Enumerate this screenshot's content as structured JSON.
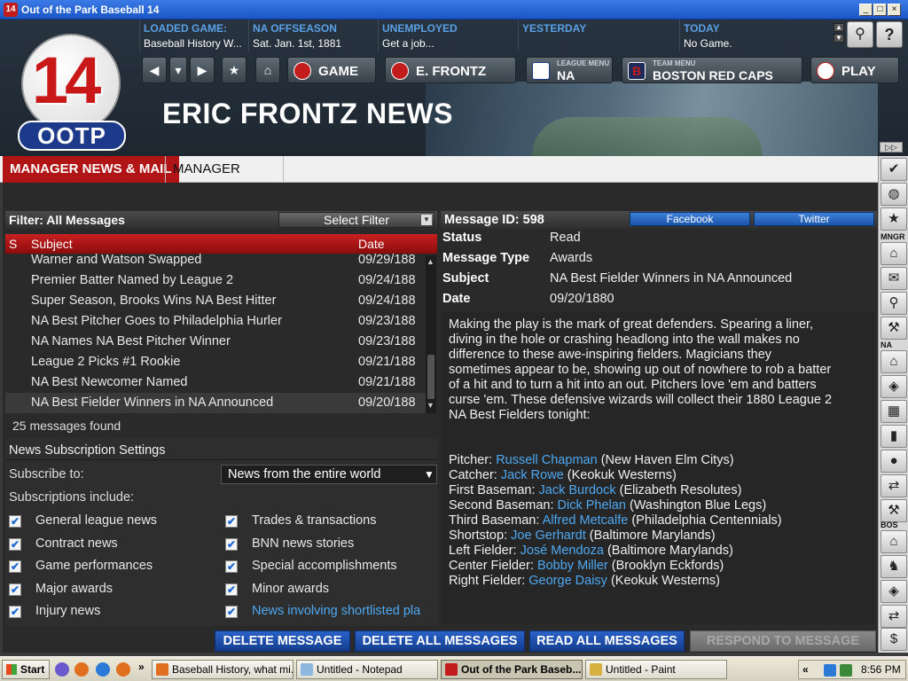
{
  "window": {
    "title": "Out of the Park Baseball 14",
    "app_icon": "14"
  },
  "logo": {
    "number": "14",
    "text": "OOTP"
  },
  "info": [
    {
      "label": "LOADED GAME:",
      "value": "Baseball History W..."
    },
    {
      "label": "NA OFFSEASON",
      "value": "Sat. Jan. 1st, 1881"
    },
    {
      "label": "UNEMPLOYED",
      "value": "Get a job..."
    },
    {
      "label": "YESTERDAY",
      "value": ""
    },
    {
      "label": "TODAY",
      "value": "No Game."
    }
  ],
  "nav": {
    "game": "GAME",
    "manager": "E. FRONTZ",
    "league_sub": "LEAGUE MENU",
    "league": "NA",
    "team_sub": "TEAM MENU",
    "team": "BOSTON RED CAPS",
    "play": "PLAY"
  },
  "page_title": "ERIC FRONTZ NEWS",
  "tabs": [
    "MANAGER NEWS & MAIL",
    "MANAGER NOTES"
  ],
  "filter": {
    "label": "Filter: All Messages",
    "select": "Select Filter"
  },
  "columns": {
    "s": "S",
    "subject": "Subject",
    "date": "Date"
  },
  "messages": [
    {
      "subject": "Warner and Watson Swapped",
      "date": "09/29/188"
    },
    {
      "subject": "Premier Batter Named by League 2",
      "date": "09/24/188"
    },
    {
      "subject": "Super Season, Brooks Wins NA Best Hitter",
      "date": "09/24/188"
    },
    {
      "subject": "NA Best Pitcher Goes to Philadelphia Hurler",
      "date": "09/23/188"
    },
    {
      "subject": "NA Names NA Best Pitcher Winner",
      "date": "09/23/188"
    },
    {
      "subject": "League 2 Picks #1 Rookie",
      "date": "09/21/188"
    },
    {
      "subject": "NA Best Newcomer Named",
      "date": "09/21/188"
    },
    {
      "subject": "NA Best Fielder Winners in NA Announced",
      "date": "09/20/188"
    }
  ],
  "count_text": "25 messages found",
  "subscriptions": {
    "header": "News Subscription Settings",
    "subscribe_label": "Subscribe to:",
    "subscribe_value": "News from the entire world",
    "include_label": "Subscriptions include:",
    "items": [
      "General league news",
      "Trades & transactions",
      "Contract news",
      "BNN news stories",
      "Game performances",
      "Special accomplishments",
      "Major awards",
      "Minor awards",
      "Injury news",
      "News involving shortlisted pla"
    ]
  },
  "message": {
    "id_label": "Message ID: 598",
    "facebook": "Facebook",
    "twitter": "Twitter",
    "fields": [
      {
        "key": "Status",
        "value": "Read"
      },
      {
        "key": "Message Type",
        "value": "Awards"
      },
      {
        "key": "Subject",
        "value": "NA Best Fielder Winners in NA Announced"
      },
      {
        "key": "Date",
        "value": "09/20/1880"
      }
    ],
    "body_lines": [
      "Making the play is the mark of great defenders. Spearing a liner,",
      "diving in the hole or crashing headlong into the wall makes no",
      "difference to these awe-inspiring fielders. Magicians they",
      "sometimes appear to be, showing up out of nowhere to rob a batter",
      "of a hit and to turn a hit into an out. Pitchers love 'em and batters",
      "curse 'em. These defensive wizards will collect their 1880 League 2",
      "NA Best Fielders tonight:"
    ],
    "winners": [
      {
        "pos": "Pitcher:",
        "name": "Russell Chapman",
        "team": "(New Haven Elm Citys)"
      },
      {
        "pos": "Catcher:",
        "name": "Jack Rowe",
        "team": "(Keokuk Westerns)"
      },
      {
        "pos": "First Baseman:",
        "name": "Jack Burdock",
        "team": "(Elizabeth Resolutes)"
      },
      {
        "pos": "Second Baseman:",
        "name": "Dick Phelan",
        "team": "(Washington Blue Legs)"
      },
      {
        "pos": "Third Baseman:",
        "name": "Alfred Metcalfe",
        "team": "(Philadelphia Centennials)"
      },
      {
        "pos": "Shortstop:",
        "name": "Joe Gerhardt",
        "team": "(Baltimore Marylands)"
      },
      {
        "pos": "Left Fielder:",
        "name": "José Mendoza",
        "team": "(Baltimore Marylands)"
      },
      {
        "pos": "Center Fielder:",
        "name": "Bobby Miller",
        "team": "(Brooklyn Eckfords)"
      },
      {
        "pos": "Right Fielder:",
        "name": "George Daisy",
        "team": "(Keokuk Westerns)"
      }
    ]
  },
  "footer": {
    "delete": "DELETE MESSAGE",
    "delete_all": "DELETE ALL MESSAGES",
    "read_all": "READ ALL MESSAGES",
    "respond": "RESPOND TO MESSAGE"
  },
  "sidebar_labels": {
    "mngr": "MNGR",
    "na": "NA",
    "bos": "BOS"
  },
  "taskbar": {
    "start": "Start",
    "items": [
      "Baseball History, what mi...",
      "Untitled - Notepad",
      "Out of the Park Baseb...",
      "Untitled - Paint"
    ],
    "clock": "8:56 PM"
  },
  "colors": {
    "accent_red": "#b01414",
    "link_blue": "#4ea8f2",
    "label_blue": "#5aa0e6",
    "button_blue": "#1b55ab"
  }
}
